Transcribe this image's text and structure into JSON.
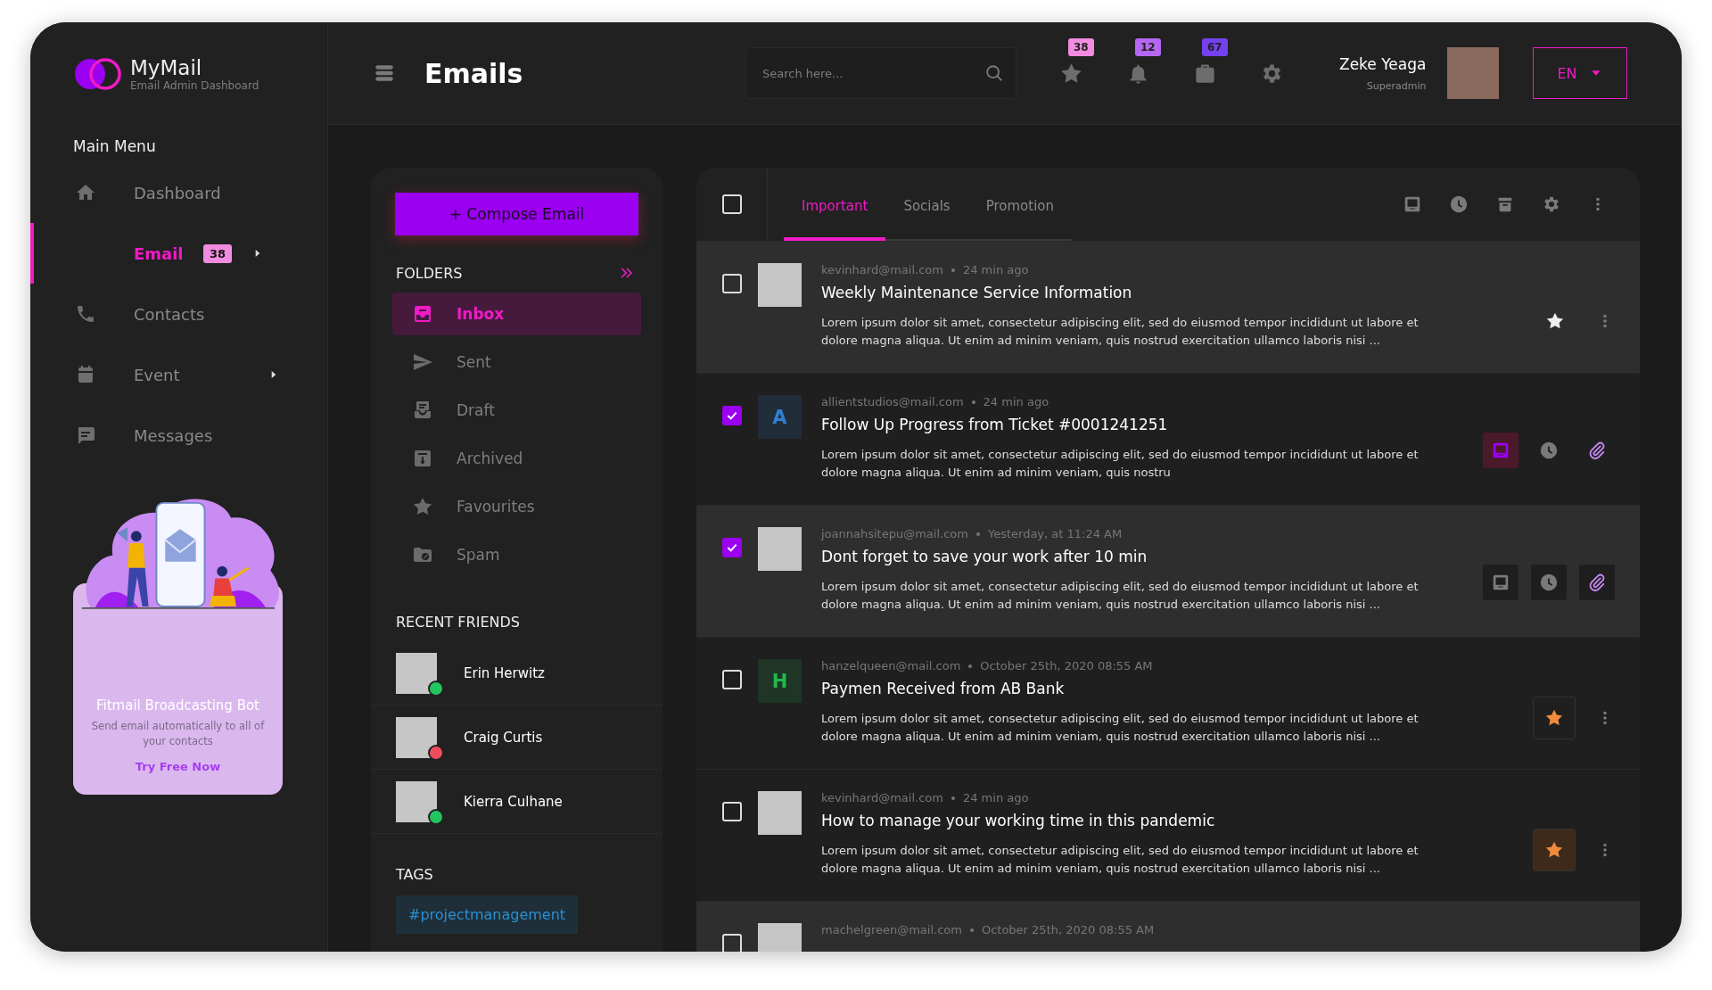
{
  "brand": {
    "name": "MyMail",
    "subtitle": "Email Admin Dashboard"
  },
  "main_menu": {
    "title": "Main Menu",
    "items": [
      {
        "label": "Dashboard",
        "selected": false,
        "submenu": false
      },
      {
        "label": "Email",
        "selected": true,
        "badge": "38",
        "submenu": true
      },
      {
        "label": "Contacts",
        "selected": false,
        "submenu": false
      },
      {
        "label": "Event",
        "selected": false,
        "submenu": true
      },
      {
        "label": "Messages",
        "selected": false,
        "submenu": false
      }
    ]
  },
  "promo": {
    "title": "Fitmail Broadcasting Bot",
    "text": "Send email automatically to all of your contacts",
    "link": "Try Free Now"
  },
  "header": {
    "title": "Emails",
    "search": {
      "placeholder": "Search here..."
    },
    "icons": [
      {
        "badge": "38",
        "color": "#f28ce0"
      },
      {
        "badge": "12",
        "color": "#b467f2"
      },
      {
        "badge": "67",
        "color": "#7440f0"
      }
    ],
    "user": {
      "name": "Zeke Yeaga",
      "role": "Superadmin"
    },
    "language": "EN"
  },
  "compose_button": "+ Compose Email",
  "folders": {
    "title": "FOLDERS",
    "items": [
      {
        "label": "Inbox",
        "selected": true
      },
      {
        "label": "Sent",
        "selected": false
      },
      {
        "label": "Draft",
        "selected": false
      },
      {
        "label": "Archived",
        "selected": false
      },
      {
        "label": "Favourites",
        "selected": false
      },
      {
        "label": "Spam",
        "selected": false
      }
    ]
  },
  "recent_friends": {
    "title": "RECENT FRIENDS",
    "items": [
      {
        "name": "Erin Herwitz",
        "color": "#22c55e"
      },
      {
        "name": "Craig Curtis",
        "color": "#ef4d5e"
      },
      {
        "name": "Kierra Culhane",
        "color": "#22c55e"
      }
    ]
  },
  "tags": {
    "title": "TAGS",
    "items": [
      "#projectmanagement"
    ]
  },
  "select_all": {
    "checked": false
  },
  "tabs": [
    {
      "label": "Important",
      "selected": true
    },
    {
      "label": "Socials",
      "selected": false
    },
    {
      "label": "Promotion",
      "selected": false
    }
  ],
  "emails": [
    {
      "checked": false,
      "shaded": true,
      "sender": "kevinhard@mail.com",
      "time": "24 min ago",
      "subject": "Weekly Maintenance Service Information",
      "body": "Lorem ipsum dolor sit amet, consectetur adipiscing elit, sed do eiusmod tempor incididunt ut labore et dolore magna aliqua. Ut enim ad minim veniam, quis nostrud exercitation ullamco laboris nisi ...",
      "kind": "star",
      "starred": false,
      "highlighted": false
    },
    {
      "checked": true,
      "shaded": false,
      "avatar": {
        "letter": "A",
        "color": "#2f7fd3"
      },
      "sender": "allientstudios@mail.com",
      "time": "24 min ago",
      "subject": "Follow Up Progress from Ticket #0001241251",
      "body": "Lorem ipsum dolor sit amet, consectetur adipiscing elit, sed do eiusmod tempor incididunt ut labore et dolore magna aliqua. Ut enim ad minim veniam, quis nostru",
      "kind": "tools",
      "tool_active": true
    },
    {
      "checked": true,
      "shaded": true,
      "sender": "joannahsitepu@mail.com",
      "time": "Yesterday, at 11:24 AM",
      "subject": "Dont forget to save your work after 10 min",
      "body": "Lorem ipsum dolor sit amet, consectetur adipiscing elit, sed do eiusmod tempor incididunt ut labore et dolore magna aliqua. Ut enim ad minim veniam, quis nostrud exercitation ullamco laboris nisi ...",
      "kind": "tools",
      "tool_active": false
    },
    {
      "checked": false,
      "shaded": false,
      "avatar": {
        "letter": "H",
        "color": "#22b84a"
      },
      "sender": "hanzelqueen@mail.com",
      "time": "October 25th, 2020  08:55 AM",
      "subject": "Paymen Received from AB Bank",
      "body": "Lorem ipsum dolor sit amet, consectetur adipiscing elit, sed do eiusmod tempor incididunt ut labore et dolore magna aliqua. Ut enim ad minim veniam, quis nostrud exercitation ullamco laboris nisi ...",
      "kind": "star",
      "starred": true,
      "highlighted": false
    },
    {
      "checked": false,
      "shaded": false,
      "sender": "kevinhard@mail.com",
      "time": "24 min ago",
      "subject": "How to manage your working time in this pandemic",
      "body": "Lorem ipsum dolor sit amet, consectetur adipiscing elit, sed do eiusmod tempor incididunt ut labore et dolore magna aliqua. Ut enim ad minim veniam, quis nostrud exercitation ullamco laboris nisi ...",
      "kind": "star",
      "starred": true,
      "highlighted": true
    },
    {
      "checked": false,
      "shaded": true,
      "sender": "machelgreen@mail.com",
      "time": "October 25th, 2020  08:55 AM"
    }
  ]
}
